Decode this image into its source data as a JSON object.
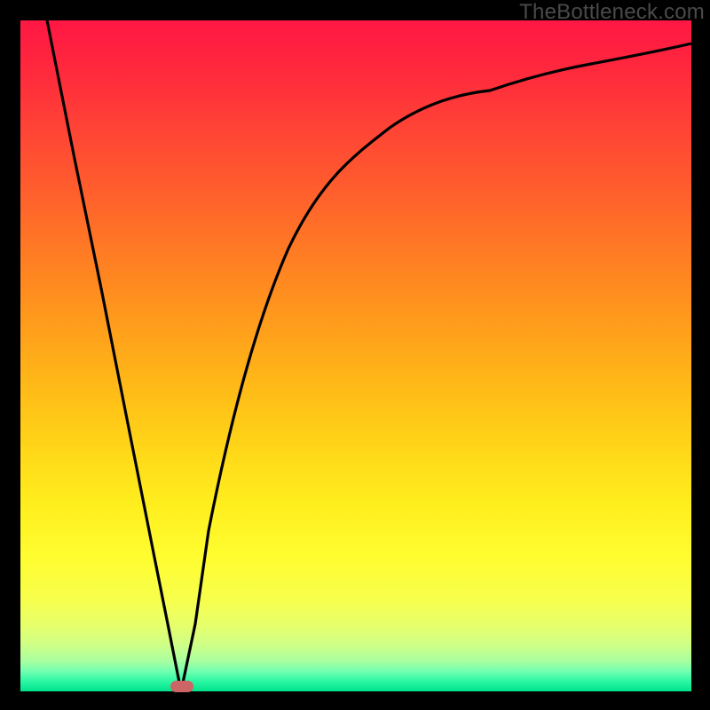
{
  "watermark": "TheBottleneck.com",
  "colors": {
    "frame": "#000000",
    "curve_stroke": "#000000",
    "marker_fill": "#cc6666",
    "gradient_top": "#ff1744",
    "gradient_bottom": "#00e28c"
  },
  "chart_data": {
    "type": "line",
    "title": "",
    "xlabel": "",
    "ylabel": "",
    "xlim": [
      0,
      100
    ],
    "ylim": [
      0,
      100
    ],
    "grid": false,
    "legend": false,
    "series": [
      {
        "name": "bottleneck-curve",
        "x": [
          4,
          8,
          12,
          16,
          20,
          22,
          24,
          26,
          28,
          32,
          36,
          40,
          45,
          50,
          55,
          60,
          65,
          70,
          75,
          80,
          85,
          90,
          95,
          100
        ],
        "y": [
          100,
          80,
          60,
          40,
          20,
          10,
          0,
          10,
          24,
          44,
          57,
          66,
          74,
          80,
          84,
          87,
          89.5,
          91.3,
          92.7,
          93.8,
          94.7,
          95.4,
          96,
          96.5
        ]
      }
    ],
    "annotations": [
      {
        "name": "optimal-marker",
        "x": 24,
        "y": 0,
        "shape": "pill",
        "color": "#cc6666"
      }
    ]
  }
}
